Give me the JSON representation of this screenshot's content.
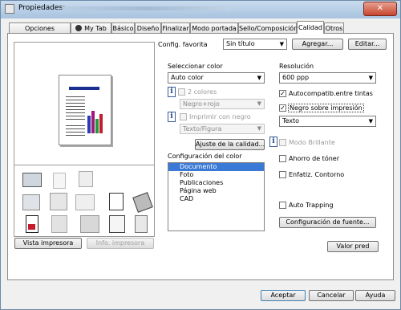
{
  "window": {
    "title": "Propiedades:",
    "close_label": "✕"
  },
  "tabs": [
    {
      "label": "Opciones avanzadas"
    },
    {
      "label": "My Tab"
    },
    {
      "label": "Básico"
    },
    {
      "label": "Diseño"
    },
    {
      "label": "Finalizar"
    },
    {
      "label": "Modo portada"
    },
    {
      "label": "Sello/Composición"
    },
    {
      "label": "Calidad"
    },
    {
      "label": "Otros"
    }
  ],
  "config": {
    "label": "Config. favorita",
    "value": "Sin título",
    "add": "Agregar...",
    "edit": "Editar..."
  },
  "preview": {
    "view_printer": "Vista impresora",
    "printer_info": "Info. impresora"
  },
  "color": {
    "select_label": "Seleccionar color",
    "select_value": "Auto color",
    "two_colors": "2 colores",
    "two_colors_value": "Negro+rojo",
    "print_black": "Imprimir con negro",
    "print_black_value": "Texto/Figura",
    "adjust_quality": "Ajuste de la calidad...",
    "config_label": "Configuración del color",
    "list": [
      "Documento",
      "Foto",
      "Publicaciones",
      "Página web",
      "CAD"
    ]
  },
  "resolution": {
    "label": "Resolución",
    "value": "600 ppp",
    "auto_compat": "Autocompatib.entre tintas",
    "black_over": "Negro sobre impresión",
    "black_over_value": "Texto",
    "bright_mode": "Modo Brillante",
    "toner_save": "Ahorro de tóner",
    "enfatiz": "Enfatiz. Contorno",
    "auto_trapping": "Auto Trapping",
    "font_config": "Configuración de fuente..."
  },
  "footer": {
    "default": "Valor pred",
    "ok": "Aceptar",
    "cancel": "Cancelar",
    "help": "Ayuda"
  },
  "icons": {
    "info": "i",
    "check": "✓",
    "arrow": "▼"
  }
}
